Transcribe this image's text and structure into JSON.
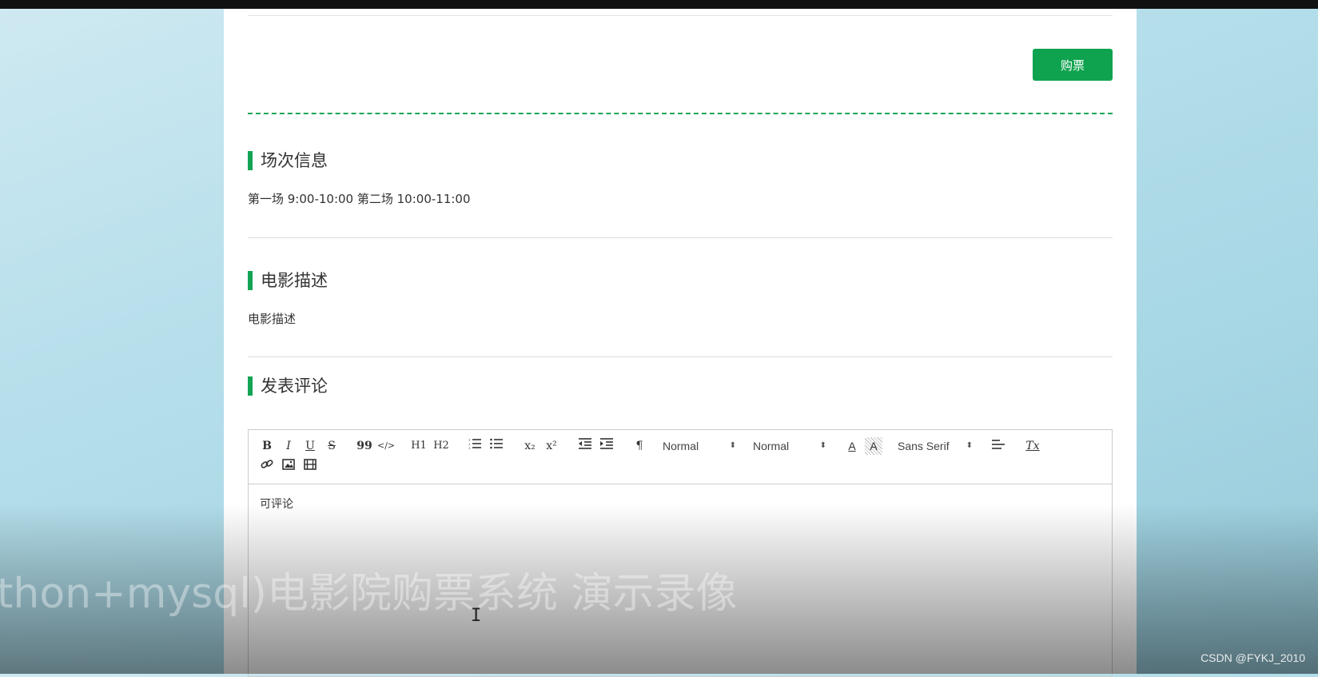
{
  "buy_button": "购票",
  "sections": {
    "schedule": {
      "title": "场次信息",
      "text": "第一场 9:00-10:00 第二场 10:00-11:00"
    },
    "description": {
      "title": "电影描述",
      "text": "电影描述"
    },
    "comment": {
      "title": "发表评论"
    }
  },
  "editor": {
    "toolbar": {
      "bold": "B",
      "italic": "I",
      "underline": "U",
      "strike": "S",
      "blockquote": "99",
      "code": "</>",
      "h1": "H1",
      "h2": "H2",
      "subscript": "x₂",
      "superscript": "x²",
      "direction": "¶",
      "size_select": "Normal",
      "header_select": "Normal",
      "font_select": "Sans Serif",
      "clean": "Tx"
    },
    "content": "可评论"
  },
  "overlay_title": "thon+mysql)电影院购票系统 演示录像",
  "watermark": "CSDN @FYKJ_2010",
  "colors": {
    "accent": "#0fa34f",
    "page_bg": "#ffffff",
    "backdrop": "#b6dfeb"
  }
}
